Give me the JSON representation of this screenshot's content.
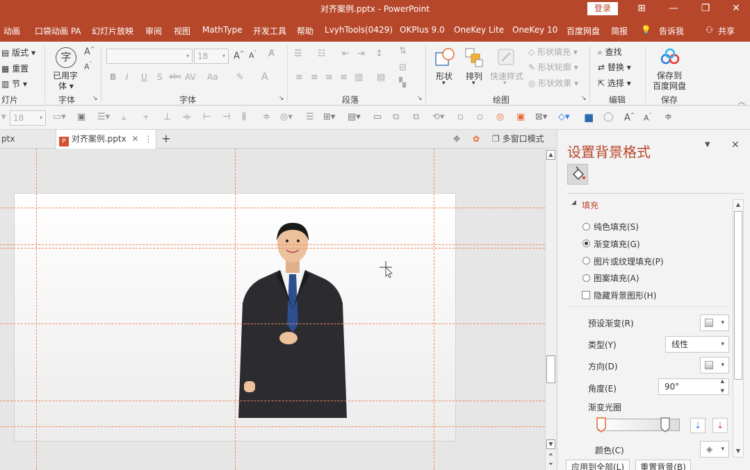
{
  "window": {
    "title": "对齐案例.pptx - PowerPoint",
    "login_label": "登录"
  },
  "menu_tabs": [
    "动画",
    "口袋动画 PA",
    "幻灯片放映",
    "审阅",
    "视图",
    "MathType",
    "开发工具",
    "帮助",
    "LvyhTools(0429)",
    "OKPlus 9.0",
    "OneKey Lite",
    "OneKey 10",
    "百度网盘",
    "简报",
    "告诉我",
    "共享"
  ],
  "ribbon": {
    "slides_group": {
      "layout": "版式",
      "reset": "重置",
      "section": "节",
      "label": "灯片"
    },
    "font_used": {
      "line1": "已用字",
      "line2": "体",
      "label": "字体"
    },
    "font_group": {
      "size": "18",
      "bold": "B",
      "italic": "I",
      "underline": "U",
      "shadow": "S",
      "strike": "abc",
      "spacing": "AV",
      "case": "Aa",
      "color": "A",
      "label": "字体"
    },
    "paragraph_group": {
      "label": "段落"
    },
    "drawing_group": {
      "shapes": "形状",
      "arrange": "排列",
      "quick_styles": "快速样式",
      "shape_fill": "形状填充",
      "shape_outline": "形状轮廓",
      "shape_effects": "形状效果",
      "label": "绘图"
    },
    "editing_group": {
      "find": "查找",
      "replace": "替换",
      "select": "选择",
      "label": "编辑"
    },
    "save_group": {
      "line1": "保存到",
      "line2": "百度网盘",
      "label": "保存"
    }
  },
  "qat": {
    "font_size": "18"
  },
  "doc_tabs": {
    "prev_tab": "ptx",
    "active_tab": "对齐案例.pptx",
    "multi_window": "多窗口模式"
  },
  "pane": {
    "title": "设置背景格式",
    "section": "填充",
    "options": [
      {
        "label": "纯色填充(S)",
        "selected": false
      },
      {
        "label": "渐变填充(G)",
        "selected": true
      },
      {
        "label": "图片或纹理填充(P)",
        "selected": false
      },
      {
        "label": "图案填充(A)",
        "selected": false
      }
    ],
    "hide_bg": "隐藏背景图形(H)",
    "preset": "预设渐变(R)",
    "type_label": "类型(Y)",
    "type_value": "线性",
    "direction": "方向(D)",
    "angle_label": "角度(E)",
    "angle_value": "90°",
    "stops_label": "渐变光圈",
    "color_label": "颜色(C)",
    "apply_all": "应用到全部(L)",
    "reset_bg": "重置背景(B)"
  },
  "colors": {
    "accent": "#b7472a",
    "guide": "#f08a5d"
  }
}
